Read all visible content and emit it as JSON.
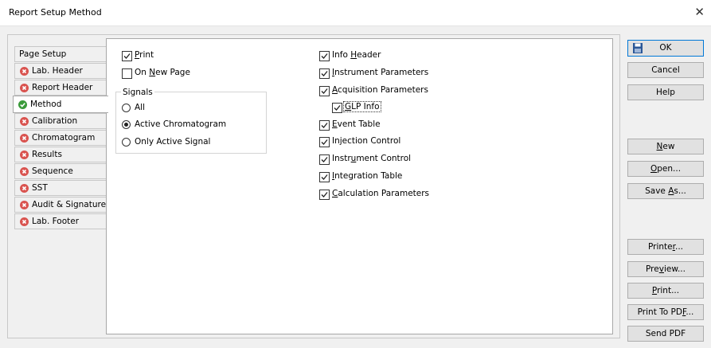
{
  "window": {
    "title": "Report Setup Method",
    "close_icon": "close-icon"
  },
  "tabs": [
    {
      "label": "Page Setup",
      "icon": "none"
    },
    {
      "label": "Lab. Header",
      "icon": "error-icon"
    },
    {
      "label": "Report Header",
      "icon": "error-icon"
    },
    {
      "label": "Method",
      "icon": "check-icon",
      "active": true
    },
    {
      "label": "Calibration",
      "icon": "error-icon"
    },
    {
      "label": "Chromatogram",
      "icon": "error-icon"
    },
    {
      "label": "Results",
      "icon": "error-icon"
    },
    {
      "label": "Sequence",
      "icon": "error-icon"
    },
    {
      "label": "SST",
      "icon": "error-icon"
    },
    {
      "label": "Audit & Signatures",
      "icon": "error-icon"
    },
    {
      "label": "Lab. Footer",
      "icon": "error-icon"
    }
  ],
  "left_options": {
    "print": {
      "pre": "",
      "key": "P",
      "post": "rint",
      "checked": true
    },
    "on_new_page": {
      "pre": "On ",
      "key": "N",
      "post": "ew Page",
      "checked": false
    }
  },
  "signals": {
    "title": "Signals",
    "options": [
      {
        "label": "All",
        "selected": false
      },
      {
        "label": "Active Chromatogram",
        "selected": true
      },
      {
        "label": "Only Active Signal",
        "selected": false
      }
    ]
  },
  "right_options": [
    {
      "pre": "Info ",
      "key": "H",
      "post": "eader",
      "checked": true
    },
    {
      "pre": "",
      "key": "I",
      "post": "nstrument Parameters",
      "checked": true
    },
    {
      "pre": "",
      "key": "A",
      "post": "cquisition Parameters",
      "checked": true
    },
    {
      "pre": "",
      "key": "G",
      "post": "LP Info",
      "checked": true,
      "indent": true,
      "focused": true
    },
    {
      "pre": "",
      "key": "E",
      "post": "vent Table",
      "checked": true
    },
    {
      "pre": "Injection Control",
      "key": "",
      "post": "",
      "checked": true
    },
    {
      "pre": "Instr",
      "key": "u",
      "post": "ment Control",
      "checked": true
    },
    {
      "pre": "",
      "key": "I",
      "post": "ntegration Table",
      "checked": true
    },
    {
      "pre": "",
      "key": "C",
      "post": "alculation Parameters",
      "checked": true
    }
  ],
  "buttons": [
    {
      "pre": "OK",
      "key": "",
      "post": "",
      "icon": "floppy-disk-icon",
      "default": true
    },
    {
      "pre": "Cancel",
      "key": "",
      "post": ""
    },
    {
      "pre": "Help",
      "key": "",
      "post": ""
    },
    {
      "pre": "",
      "key": "N",
      "post": "ew"
    },
    {
      "pre": "",
      "key": "O",
      "post": "pen..."
    },
    {
      "pre": "Save ",
      "key": "A",
      "post": "s..."
    },
    {
      "pre": "Printe",
      "key": "r",
      "post": "..."
    },
    {
      "pre": "Pre",
      "key": "v",
      "post": "iew..."
    },
    {
      "pre": "",
      "key": "P",
      "post": "rint..."
    },
    {
      "pre": "Print To PD",
      "key": "F",
      "post": "..."
    },
    {
      "pre": "Send PDF",
      "key": "",
      "post": ""
    }
  ],
  "colors": {
    "error": "#d9534f",
    "ok": "#3a9a3a",
    "accent": "#0078d7"
  }
}
